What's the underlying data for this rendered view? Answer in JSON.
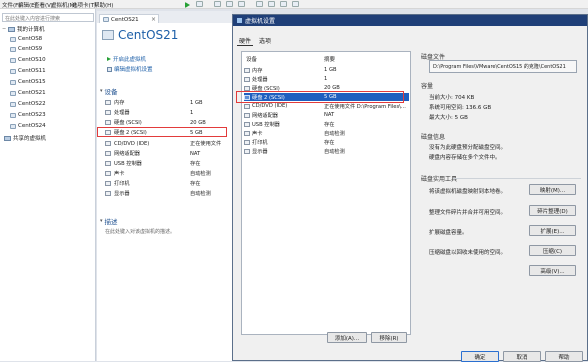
{
  "menubar": {
    "items": [
      "文件(F)",
      "编辑(E)",
      "查看(V)",
      "虚拟机(M)",
      "选项卡(T)",
      "帮助(H)"
    ]
  },
  "library": {
    "search_placeholder": "在此处键入内容进行搜索",
    "root": "我的计算机",
    "vms": [
      "CentOS8",
      "CentOS9",
      "CentOS10",
      "CentOS11",
      "CentOS15",
      "CentOS21",
      "CentOS22",
      "CentOS23",
      "CentOS24"
    ],
    "shared": "共享的虚拟机"
  },
  "tab": {
    "label": "CentOS21",
    "close": "×"
  },
  "vm": {
    "title": "CentOS21",
    "actions": [
      "开启此虚拟机",
      "编辑虚拟机设置"
    ],
    "devices_header": "设备",
    "devices": [
      {
        "name": "内存",
        "value": "1 GB"
      },
      {
        "name": "处理器",
        "value": "1"
      },
      {
        "name": "硬盘 (SCSI)",
        "value": "20 GB"
      },
      {
        "name": "硬盘 2 (SCSI)",
        "value": "5 GB"
      },
      {
        "name": "CD/DVD (IDE)",
        "value": "正在使用文件"
      },
      {
        "name": "网络适配器",
        "value": "NAT"
      },
      {
        "name": "USB 控制器",
        "value": "存在"
      },
      {
        "name": "声卡",
        "value": "自动检测"
      },
      {
        "name": "打印机",
        "value": "存在"
      },
      {
        "name": "显示器",
        "value": "自动检测"
      }
    ],
    "description_header": "描述",
    "description_text": "在此处键入对该虚拟机的描述。"
  },
  "dialog": {
    "title": "虚拟机设置",
    "tabs": [
      "硬件",
      "选项"
    ],
    "columns": [
      "设备",
      "摘要"
    ],
    "hardware": [
      {
        "name": "内存",
        "value": "1 GB"
      },
      {
        "name": "处理器",
        "value": "1"
      },
      {
        "name": "硬盘 (SCSI)",
        "value": "20 GB"
      },
      {
        "name": "硬盘 2 (SCSI)",
        "value": "5 GB"
      },
      {
        "name": "CD/DVD (IDE)",
        "value": "正在使用文件 D:\\Program Files\\..."
      },
      {
        "name": "网络适配器",
        "value": "NAT"
      },
      {
        "name": "USB 控制器",
        "value": "存在"
      },
      {
        "name": "声卡",
        "value": "自动检测"
      },
      {
        "name": "打印机",
        "value": "存在"
      },
      {
        "name": "显示器",
        "value": "自动检测"
      }
    ],
    "add_button": "添加(A)...",
    "remove_button": "移除(R)",
    "disk_file_header": "磁盘文件",
    "disk_file_path": "D:\\Program Files\\VMware\\CentOS15 的克隆\\CentOS21",
    "capacity_header": "容量",
    "current_size": "当前大小: 704 KB",
    "free_space": "系统可用空间: 136.6 GB",
    "max_size": "最大大小: 5 GB",
    "disk_info_header": "磁盘信息",
    "disk_info_1": "没有为此硬盘预分配磁盘空间。",
    "disk_info_2": "硬盘内容存储在多个文件中。",
    "disk_utilities_header": "磁盘实用工具",
    "util_map_text": "将该虚拟机磁盘映射到本地卷。",
    "util_map_btn": "映射(M)...",
    "util_defrag_text": "整理文件碎片并合并可用空间。",
    "util_defrag_btn": "碎片整理(D)",
    "util_expand_text": "扩展磁盘容量。",
    "util_expand_btn": "扩展(E)...",
    "util_compact_text": "压缩磁盘以回收未使用的空间。",
    "util_compact_btn": "压缩(C)",
    "advanced_btn": "高级(V)...",
    "ok_btn": "确定",
    "cancel_btn": "取消",
    "help_btn": "帮助"
  },
  "colors": {
    "highlight_red": "#e23b3b",
    "title_bar": "#1f3f78",
    "selection": "#1f5fbf",
    "link_blue": "#1d5fa8"
  }
}
